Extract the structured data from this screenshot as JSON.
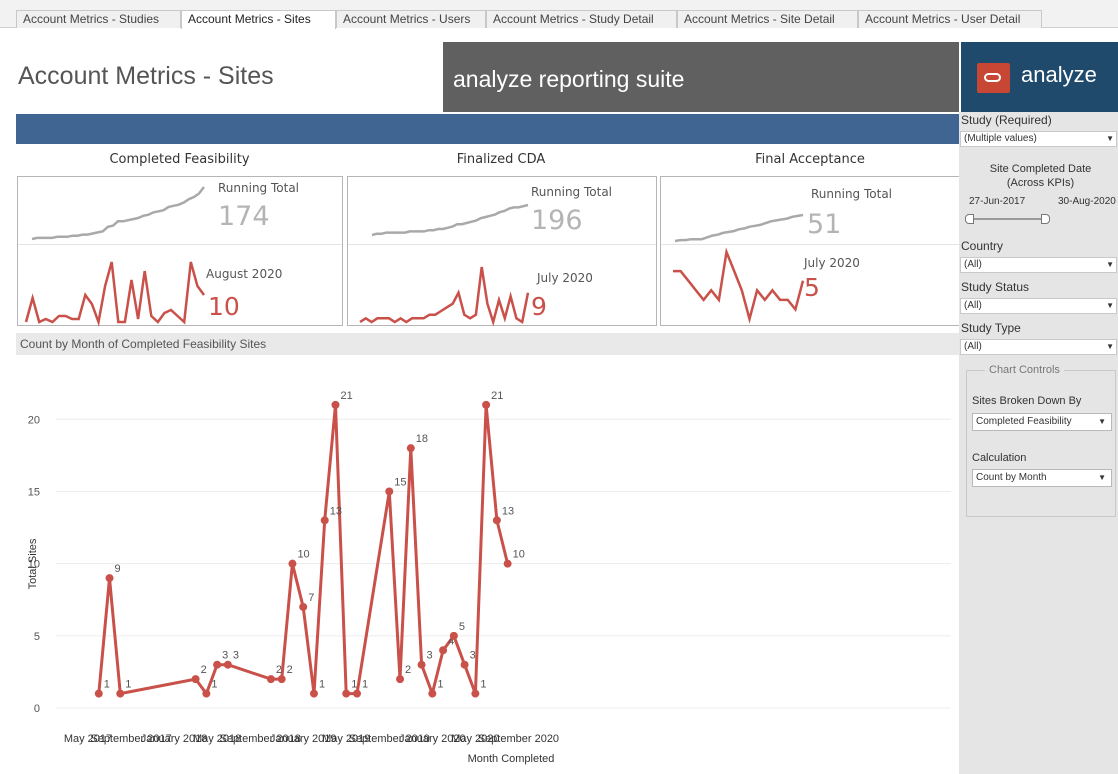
{
  "tabs": [
    {
      "label": "Account Metrics - Studies",
      "active": false
    },
    {
      "label": "Account Metrics - Sites",
      "active": true
    },
    {
      "label": "Account Metrics - Users",
      "active": false
    },
    {
      "label": "Account Metrics - Study Detail",
      "active": false
    },
    {
      "label": "Account Metrics - Site Detail",
      "active": false
    },
    {
      "label": "Account Metrics - User Detail",
      "active": false
    }
  ],
  "header": {
    "page_title": "Account Metrics - Sites",
    "suite_title": "analyze reporting suite",
    "logo_text": "analyze",
    "brand_colors": {
      "bar": "#416592",
      "logo_bg": "#1f4a6c",
      "logo_mark": "#c74634",
      "suite_bg": "#606060"
    }
  },
  "kpis": [
    {
      "title": "Completed Feasibility",
      "total_label": "Running Total",
      "total": "174",
      "month_label": "August 2020",
      "month_value": "10"
    },
    {
      "title": "Finalized CDA",
      "total_label": "Running Total",
      "total": "196",
      "month_label": "July 2020",
      "month_value": "9"
    },
    {
      "title": "Final Acceptance",
      "total_label": "Running Total",
      "total": "51",
      "month_label": "July 2020",
      "month_value": "5"
    }
  ],
  "filters": {
    "study_label": "Study (Required)",
    "study_value": "(Multiple values)",
    "date_title_line1": "Site Completed Date",
    "date_title_line2": "(Across KPIs)",
    "date_start": "27-Jun-2017",
    "date_end": "30-Aug-2020",
    "country_label": "Country",
    "country_value": "(All)",
    "status_label": "Study Status",
    "status_value": "(All)",
    "type_label": "Study Type",
    "type_value": "(All)"
  },
  "chart_controls": {
    "legend": "Chart Controls",
    "breakdown_label": "Sites Broken Down By",
    "breakdown_value": "Completed Feasibility",
    "calc_label": "Calculation",
    "calc_value": "Count by Month"
  },
  "chart_data": {
    "type": "line",
    "title": "Count by Month of Completed Feasibility Sites",
    "xlabel": "Month Completed",
    "ylabel": "Total Sites",
    "ylim": [
      0,
      23
    ],
    "yticks": [
      0,
      5,
      10,
      15,
      20
    ],
    "xticks": [
      "May 2017",
      "September 2017",
      "January 2018",
      "May 2018",
      "September 2018",
      "January 2019",
      "May 2019",
      "September 2019",
      "January 2020",
      "May 2020",
      "September 2020"
    ],
    "color": "#c9514a",
    "series": [
      {
        "x": [
          "2017-06",
          "2017-07",
          "2017-08",
          "2018-03",
          "2018-04",
          "2018-05",
          "2018-06",
          "2018-10",
          "2018-11",
          "2018-12",
          "2019-01",
          "2019-02",
          "2019-03",
          "2019-04",
          "2019-05",
          "2019-06",
          "2019-09",
          "2019-10",
          "2019-11",
          "2019-12",
          "2020-01",
          "2020-02",
          "2020-03",
          "2020-04",
          "2020-05",
          "2020-06",
          "2020-07",
          "2020-08"
        ],
        "values": [
          1,
          9,
          1,
          2,
          1,
          3,
          3,
          2,
          2,
          10,
          7,
          1,
          13,
          21,
          1,
          1,
          15,
          2,
          18,
          3,
          1,
          4,
          5,
          3,
          1,
          21,
          13,
          10
        ]
      }
    ]
  },
  "kpi_sparklines": [
    {
      "running": [
        12,
        13,
        13,
        13,
        13,
        14,
        14,
        14,
        15,
        15,
        16,
        16,
        17,
        18,
        19,
        23,
        24,
        28,
        28,
        29,
        30,
        31,
        33,
        34,
        36,
        37,
        38,
        41,
        42,
        43,
        45,
        48,
        50,
        53,
        59
      ],
      "monthly": [
        1,
        9,
        1,
        2,
        1,
        3,
        3,
        2,
        2,
        10,
        7,
        1,
        13,
        21,
        1,
        1,
        15,
        2,
        18,
        3,
        1,
        4,
        5,
        3,
        1,
        21,
        13,
        10
      ]
    },
    {
      "running": [
        10,
        11,
        11,
        12,
        12,
        12,
        12,
        12,
        13,
        13,
        13,
        13,
        14,
        14,
        15,
        15,
        16,
        17,
        19,
        19,
        20,
        21,
        22,
        24,
        25,
        26,
        27,
        29,
        30,
        32,
        33,
        33,
        34,
        35
      ],
      "monthly": [
        1,
        2,
        1,
        2,
        2,
        2,
        1,
        2,
        1,
        2,
        2,
        2,
        3,
        3,
        4,
        5,
        6,
        9,
        3,
        2,
        3,
        16,
        6,
        1,
        7,
        2,
        8,
        2,
        1,
        9
      ]
    },
    {
      "running": [
        11,
        12,
        12,
        13,
        13,
        13,
        15,
        17,
        18,
        20,
        21,
        22,
        24,
        25,
        27,
        28,
        29,
        31,
        33,
        34,
        35,
        36,
        38,
        39,
        40
      ],
      "monthly": [
        3,
        3,
        2,
        1,
        0,
        1,
        0,
        5,
        3,
        1,
        -2,
        1,
        0,
        1,
        0,
        0,
        -1,
        2
      ]
    }
  ]
}
